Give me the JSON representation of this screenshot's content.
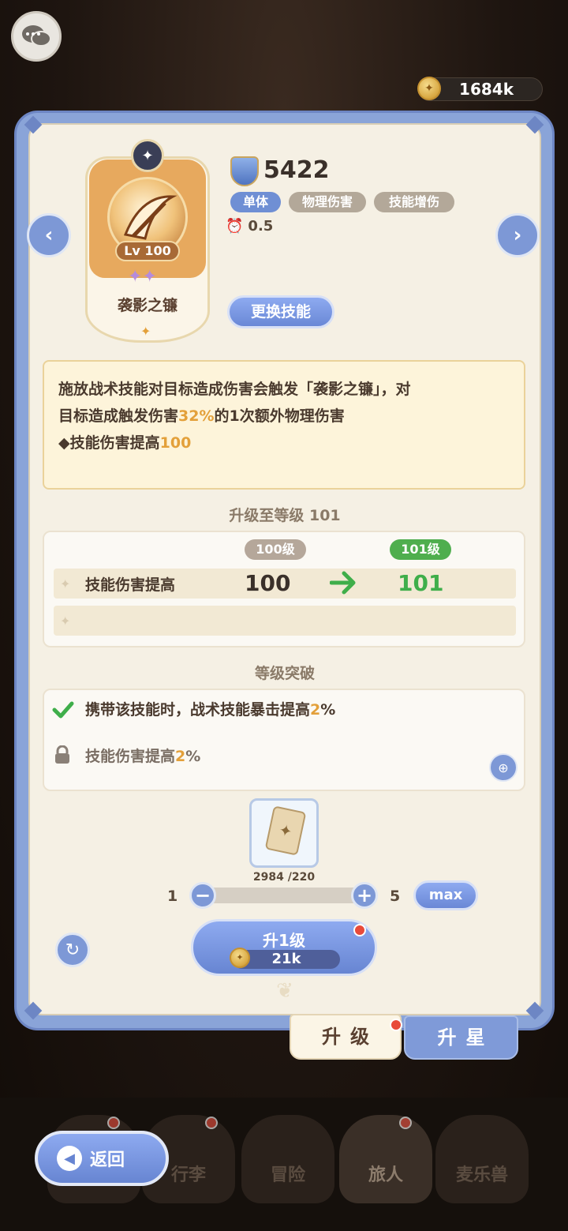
{
  "header": {
    "currency_value": "1684k"
  },
  "skill": {
    "power": "5422",
    "level": "Lv 100",
    "name": "袭影之镰",
    "tags": [
      "单体",
      "物理伤害",
      "技能增伤"
    ],
    "cooldown": "0.5",
    "change_button": "更换技能"
  },
  "description": {
    "line1": "施放战术技能对目标造成伤害会触发「袭影之镰」，对",
    "line2_prefix": "目标造成触发伤害",
    "line2_highlight": "32%",
    "line2_suffix": "的1次额外物理伤害",
    "line3_prefix": "◆技能伤害提高",
    "line3_highlight": "100"
  },
  "upgrade": {
    "title": "升级至等级 101",
    "from_level": "100级",
    "to_level": "101级",
    "stat_label": "技能伤害提高",
    "from_value": "100",
    "to_value": "101"
  },
  "breakthrough": {
    "title": "等级突破",
    "items": [
      {
        "prefix": "携带该技能时，战术技能暴击提高",
        "highlight": "2",
        "suffix": "%",
        "unlocked": true
      },
      {
        "prefix": "技能伤害提高",
        "highlight": "2",
        "suffix": "%",
        "unlocked": false
      }
    ]
  },
  "material": {
    "count": "2984 /220",
    "min": "1",
    "max": "5",
    "max_button": "max"
  },
  "action": {
    "upgrade_label": "升1级",
    "cost": "21k"
  },
  "tabs": {
    "upgrade": "升级",
    "star": "升星"
  },
  "nav": {
    "back": "返回",
    "items": [
      "行李",
      "冒险",
      "旅人",
      "麦乐兽"
    ]
  },
  "colors": {
    "accent_blue": "#7d98d6",
    "highlight_orange": "#e3a03a",
    "green": "#3fae4a",
    "panel_bg": "#f5f0e4"
  }
}
